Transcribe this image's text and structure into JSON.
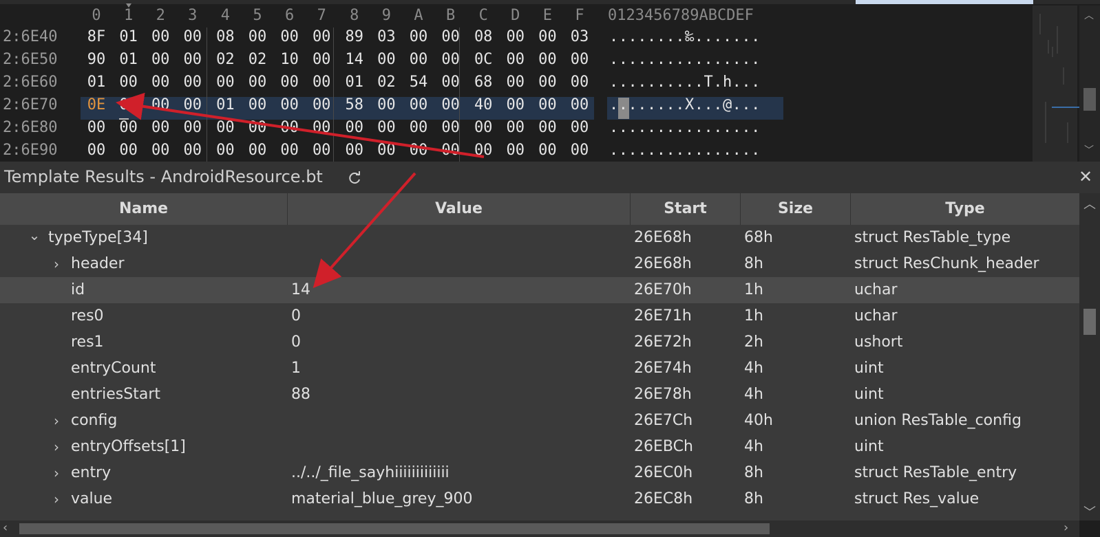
{
  "hex": {
    "column_headers": [
      "0",
      "1",
      "2",
      "3",
      "4",
      "5",
      "6",
      "7",
      "8",
      "9",
      "A",
      "B",
      "C",
      "D",
      "E",
      "F"
    ],
    "ascii_header": "0123456789ABCDEF",
    "rows": [
      {
        "address": "2:6E40",
        "bytes": [
          "8F",
          "01",
          "00",
          "00",
          "08",
          "00",
          "00",
          "00",
          "89",
          "03",
          "00",
          "00",
          "08",
          "00",
          "00",
          "03"
        ],
        "ascii": "........‰......."
      },
      {
        "address": "2:6E50",
        "bytes": [
          "90",
          "01",
          "00",
          "00",
          "02",
          "02",
          "10",
          "00",
          "14",
          "00",
          "00",
          "00",
          "0C",
          "00",
          "00",
          "00"
        ],
        "ascii": "................"
      },
      {
        "address": "2:6E60",
        "bytes": [
          "01",
          "00",
          "00",
          "00",
          "00",
          "00",
          "00",
          "00",
          "01",
          "02",
          "54",
          "00",
          "68",
          "00",
          "00",
          "00"
        ],
        "ascii": "..........T.h..."
      },
      {
        "address": "2:6E70",
        "bytes": [
          "0E",
          "00",
          "00",
          "00",
          "01",
          "00",
          "00",
          "00",
          "58",
          "00",
          "00",
          "00",
          "40",
          "00",
          "00",
          "00"
        ],
        "ascii": "........X...@..."
      },
      {
        "address": "2:6E80",
        "bytes": [
          "00",
          "00",
          "00",
          "00",
          "00",
          "00",
          "00",
          "00",
          "00",
          "00",
          "00",
          "00",
          "00",
          "00",
          "00",
          "00"
        ],
        "ascii": "................"
      },
      {
        "address": "2:6E90",
        "bytes": [
          "00",
          "00",
          "00",
          "00",
          "00",
          "00",
          "00",
          "00",
          "00",
          "00",
          "00",
          "00",
          "00",
          "00",
          "00",
          "00"
        ],
        "ascii": "................"
      }
    ],
    "selected_row": 3,
    "highlight_color": "#e3943d"
  },
  "template_results": {
    "title": "Template Results - AndroidResource.bt",
    "columns": [
      "Name",
      "Value",
      "Start",
      "Size",
      "Type"
    ],
    "rows": [
      {
        "name": "typeType[34]",
        "value": "",
        "start": "26E68h",
        "size": "68h",
        "type": "struct ResTable_type",
        "level": 0,
        "expander": "open"
      },
      {
        "name": "header",
        "value": "",
        "start": "26E68h",
        "size": "8h",
        "type": "struct ResChunk_header",
        "level": 1,
        "expander": "closed"
      },
      {
        "name": "id",
        "value": "14",
        "start": "26E70h",
        "size": "1h",
        "type": "uchar",
        "level": 1,
        "expander": "none"
      },
      {
        "name": "res0",
        "value": "0",
        "start": "26E71h",
        "size": "1h",
        "type": "uchar",
        "level": 1,
        "expander": "none"
      },
      {
        "name": "res1",
        "value": "0",
        "start": "26E72h",
        "size": "2h",
        "type": "ushort",
        "level": 1,
        "expander": "none"
      },
      {
        "name": "entryCount",
        "value": "1",
        "start": "26E74h",
        "size": "4h",
        "type": "uint",
        "level": 1,
        "expander": "none"
      },
      {
        "name": "entriesStart",
        "value": "88",
        "start": "26E78h",
        "size": "4h",
        "type": "uint",
        "level": 1,
        "expander": "none"
      },
      {
        "name": "config",
        "value": "",
        "start": "26E7Ch",
        "size": "40h",
        "type": "union ResTable_config",
        "level": 1,
        "expander": "closed"
      },
      {
        "name": "entryOffsets[1]",
        "value": "",
        "start": "26EBCh",
        "size": "4h",
        "type": "uint",
        "level": 1,
        "expander": "closed"
      },
      {
        "name": "entry",
        "value": "../../_file_sayhiiiiiiiiiiiii",
        "start": "26EC0h",
        "size": "8h",
        "type": "struct ResTable_entry",
        "level": 1,
        "expander": "closed"
      },
      {
        "name": "value",
        "value": "material_blue_grey_900",
        "start": "26EC8h",
        "size": "8h",
        "type": "struct Res_value",
        "level": 1,
        "expander": "closed"
      }
    ],
    "selected_row": 2
  },
  "annotation_color": "#d0202a"
}
